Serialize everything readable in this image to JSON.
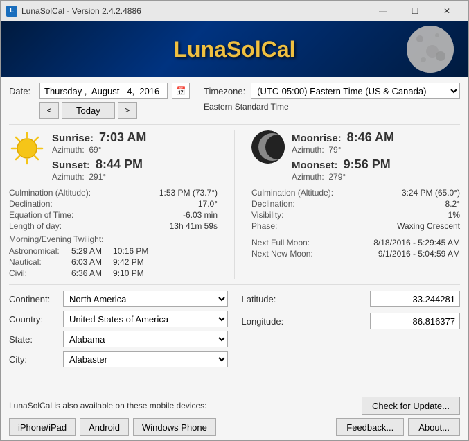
{
  "window": {
    "title": "LunaSolCal - Version 2.4.2.4886",
    "min_label": "—",
    "max_label": "☐",
    "close_label": "✕"
  },
  "header": {
    "title": "LunaSolCal"
  },
  "date": {
    "label": "Date:",
    "value": "Thursday ,  August   4,  2016",
    "today_label": "Today",
    "prev_label": "<",
    "next_label": ">"
  },
  "timezone": {
    "label": "Timezone:",
    "value": "(UTC-05:00) Eastern Time (US & Canada)",
    "standard": "Eastern Standard Time"
  },
  "sun": {
    "sunrise_label": "Sunrise:",
    "sunrise_time": "7:03 AM",
    "sunrise_azimuth_label": "Azimuth:",
    "sunrise_azimuth": "69°",
    "sunset_label": "Sunset:",
    "sunset_time": "8:44 PM",
    "sunset_azimuth_label": "Azimuth:",
    "sunset_azimuth": "291°",
    "culmination_label": "Culmination (Altitude):",
    "culmination_value": "1:53 PM (73.7°)",
    "declination_label": "Declination:",
    "declination_value": "17.0°",
    "equation_label": "Equation of Time:",
    "equation_value": "-6.03 min",
    "length_label": "Length of day:",
    "length_value": "13h 41m 59s",
    "twilight_header": "Morning/Evening Twilight:",
    "astronomical_label": "Astronomical:",
    "astronomical_morning": "5:29 AM",
    "astronomical_evening": "10:16 PM",
    "nautical_label": "Nautical:",
    "nautical_morning": "6:03 AM",
    "nautical_evening": "9:42 PM",
    "civil_label": "Civil:",
    "civil_morning": "6:36 AM",
    "civil_evening": "9:10 PM"
  },
  "moon": {
    "moonrise_label": "Moonrise:",
    "moonrise_time": "8:46 AM",
    "moonrise_azimuth_label": "Azimuth:",
    "moonrise_azimuth": "79°",
    "moonset_label": "Moonset:",
    "moonset_time": "9:56 PM",
    "moonset_azimuth_label": "Azimuth:",
    "moonset_azimuth": "279°",
    "culmination_label": "Culmination (Altitude):",
    "culmination_value": "3:24 PM (65.0°)",
    "declination_label": "Declination:",
    "declination_value": "8.2°",
    "visibility_label": "Visibility:",
    "visibility_value": "1%",
    "phase_label": "Phase:",
    "phase_value": "Waxing Crescent",
    "next_full_label": "Next Full Moon:",
    "next_full_value": "8/18/2016 - 5:29:45 AM",
    "next_new_label": "Next New Moon:",
    "next_new_value": "9/1/2016 - 5:04:59 AM"
  },
  "location": {
    "continent_label": "Continent:",
    "continent_value": "North America",
    "country_label": "Country:",
    "country_value": "United States of America",
    "state_label": "State:",
    "state_value": "Alabama",
    "city_label": "City:",
    "city_value": "Alabaster",
    "latitude_label": "Latitude:",
    "latitude_value": "33.244281",
    "longitude_label": "Longitude:",
    "longitude_value": "-86.816377"
  },
  "footer": {
    "mobile_text": "LunaSolCal is also available on these mobile devices:",
    "iphone_label": "iPhone/iPad",
    "android_label": "Android",
    "windows_phone_label": "Windows Phone",
    "check_update_label": "Check for Update...",
    "feedback_label": "Feedback...",
    "about_label": "About..."
  }
}
